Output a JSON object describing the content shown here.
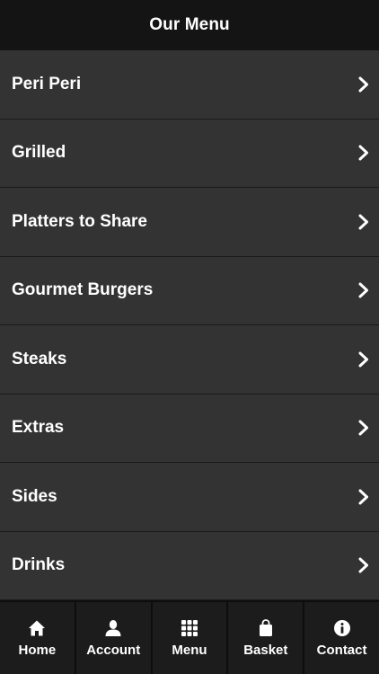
{
  "header": {
    "title": "Our Menu"
  },
  "menu": {
    "items": [
      {
        "label": "Peri Peri"
      },
      {
        "label": "Grilled"
      },
      {
        "label": "Platters to Share"
      },
      {
        "label": "Gourmet Burgers"
      },
      {
        "label": "Steaks"
      },
      {
        "label": "Extras"
      },
      {
        "label": "Sides"
      },
      {
        "label": "Drinks"
      }
    ]
  },
  "tabbar": {
    "tabs": [
      {
        "label": "Home",
        "icon": "home-icon"
      },
      {
        "label": "Account",
        "icon": "user-icon"
      },
      {
        "label": "Menu",
        "icon": "grid-icon"
      },
      {
        "label": "Basket",
        "icon": "shopping-bag-icon"
      },
      {
        "label": "Contact",
        "icon": "info-icon"
      }
    ]
  },
  "colors": {
    "header_bg": "#141414",
    "list_bg": "#333333",
    "divider": "#1a1a1a",
    "tabbar_bg": "#1c1c1c",
    "text": "#ffffff"
  }
}
